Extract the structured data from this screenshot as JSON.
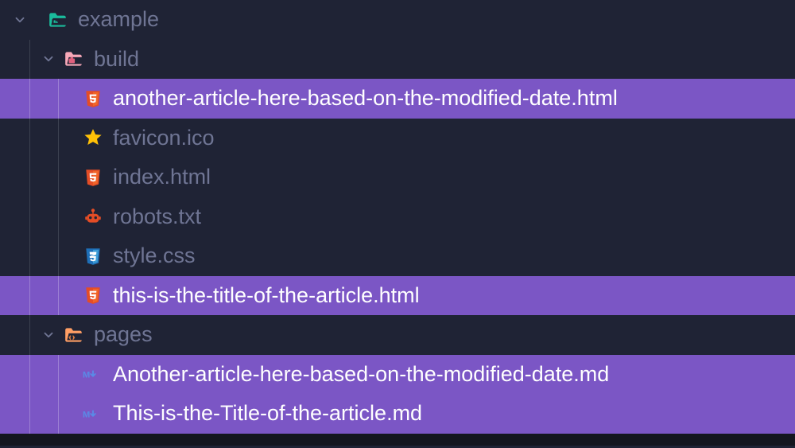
{
  "tree": {
    "root": {
      "label": "example"
    },
    "build": {
      "label": "build"
    },
    "pages": {
      "label": "pages"
    },
    "files": {
      "another_article": "another-article-here-based-on-the-modified-date.html",
      "favicon": "favicon.ico",
      "index": "index.html",
      "robots": "robots.txt",
      "style": "style.css",
      "title_article": "this-is-the-title-of-the-article.html",
      "another_md": "Another-article-here-based-on-the-modified-date.md",
      "title_md": "This-is-the-Title-of-the-article.md"
    }
  },
  "colors": {
    "bg": "#1f2335",
    "highlight": "#7b56c5",
    "text_dim": "#6f7594",
    "text_bright": "#ffffff",
    "folder_teal": "#1abc9c",
    "folder_pink": "#f7768e",
    "folder_orange": "#ff9e64",
    "html": "#e44d26",
    "css": "#42a5f5",
    "star": "#ffc107",
    "robot": "#e44d26",
    "markdown": "#5a8ae6"
  }
}
